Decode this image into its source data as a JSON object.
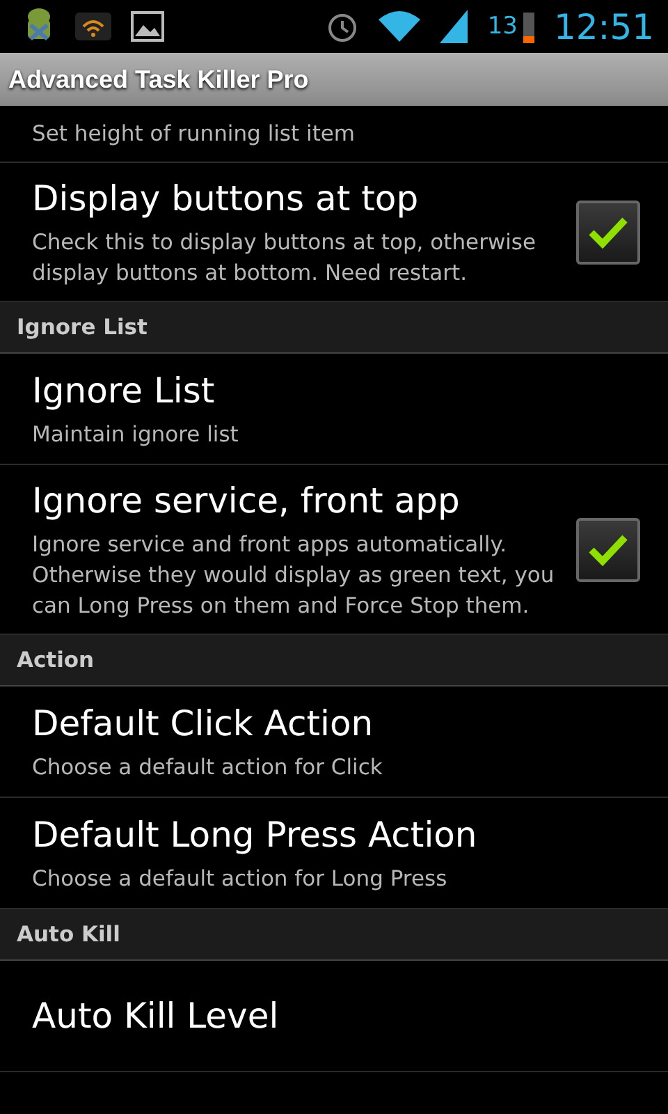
{
  "status_bar": {
    "battery_percent": "13",
    "time": "12:51"
  },
  "app_bar": {
    "title": "Advanced Task Killer Pro"
  },
  "rows": [
    {
      "kind": "partial",
      "summary": "Set height of running list item"
    },
    {
      "kind": "check",
      "title": "Display buttons at top",
      "summary": "Check this to display buttons at top, otherwise display buttons at bottom. Need restart.",
      "checked": true
    },
    {
      "kind": "header",
      "title": "Ignore List"
    },
    {
      "kind": "item",
      "title": "Ignore List",
      "summary": "Maintain ignore list"
    },
    {
      "kind": "check",
      "title": "Ignore service, front app",
      "summary": "Ignore service and front apps automatically. Otherwise they would display as green text, you can Long Press on them and Force Stop them.",
      "checked": true
    },
    {
      "kind": "header",
      "title": "Action"
    },
    {
      "kind": "item",
      "title": "Default Click Action",
      "summary": "Choose a default action for Click"
    },
    {
      "kind": "item",
      "title": "Default Long Press Action",
      "summary": "Choose a default action for Long Press"
    },
    {
      "kind": "header",
      "title": "Auto Kill"
    },
    {
      "kind": "item",
      "title": "Auto Kill Level"
    }
  ]
}
